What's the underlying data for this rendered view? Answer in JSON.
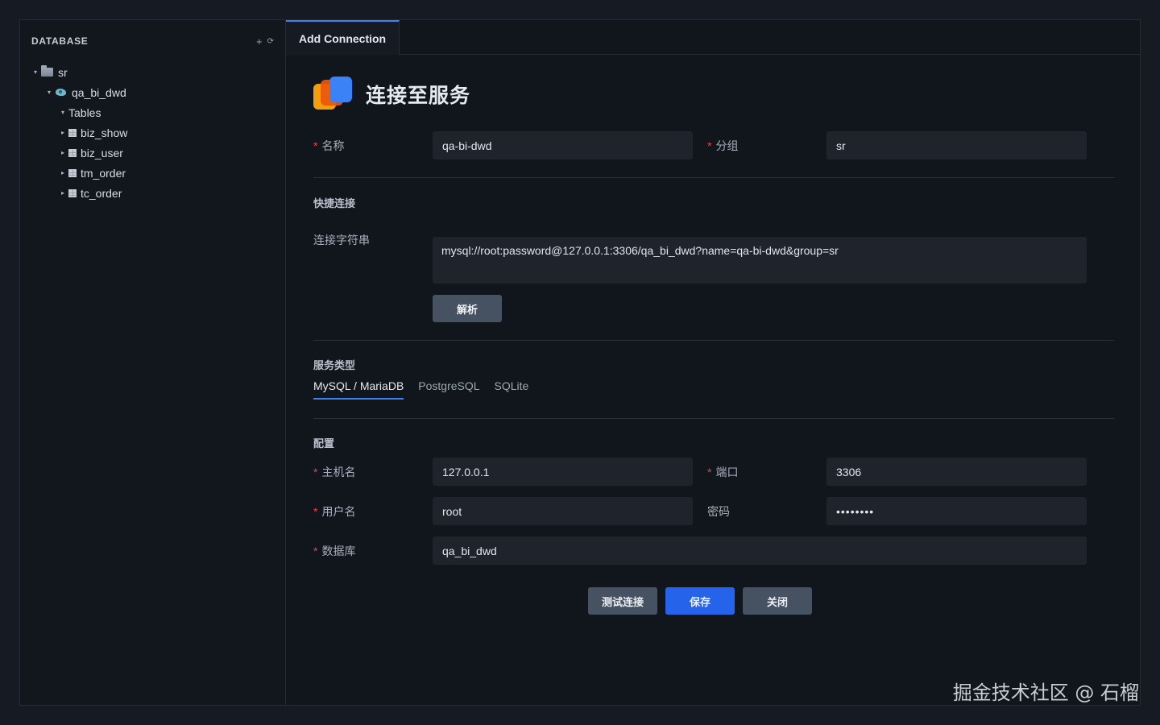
{
  "sidebar": {
    "title": "DATABASE",
    "add_icon": "+",
    "refresh_icon": "⟳",
    "tree": {
      "root": "sr",
      "database": "qa_bi_dwd",
      "group": "Tables",
      "tables": [
        "biz_show",
        "biz_user",
        "tm_order",
        "tc_order"
      ]
    }
  },
  "tabs": {
    "active": "Add Connection"
  },
  "form": {
    "title": "连接至服务",
    "name_label": "名称",
    "name_value": "qa-bi-dwd",
    "group_label": "分组",
    "group_value": "sr",
    "quick_section": "快捷连接",
    "conn_string_label": "连接字符串",
    "conn_string_value": "mysql://root:password@127.0.0.1:3306/qa_bi_dwd?name=qa-bi-dwd&group=sr",
    "parse_button": "解析",
    "service_section": "服务类型",
    "service_types": [
      "MySQL / MariaDB",
      "PostgreSQL",
      "SQLite"
    ],
    "config_section": "配置",
    "host_label": "主机名",
    "host_value": "127.0.0.1",
    "port_label": "端口",
    "port_value": "3306",
    "user_label": "用户名",
    "user_value": "root",
    "password_label": "密码",
    "password_value": "••••••••",
    "database_label": "数据库",
    "database_value": "qa_bi_dwd",
    "test_button": "测试连接",
    "save_button": "保存",
    "close_button": "关闭",
    "required_mark": "*"
  },
  "watermark": "掘金技术社区 @ 石榴",
  "colors": {
    "accent": "#3b82f6",
    "primary_button": "#2563eb",
    "required": "#ef4444"
  }
}
